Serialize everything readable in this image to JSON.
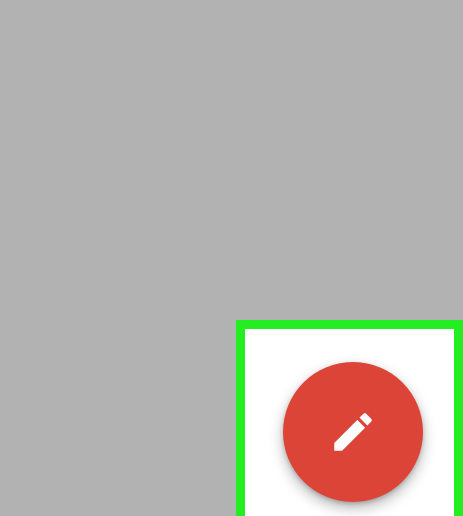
{
  "scrim": {
    "color": "#b2b2b2"
  },
  "highlight": {
    "color": "#22ee22",
    "background": "#ffffff"
  },
  "fab": {
    "icon": "pencil-icon",
    "color": "#dc4437",
    "icon_color": "#ffffff"
  }
}
